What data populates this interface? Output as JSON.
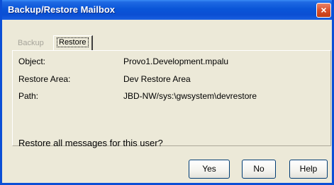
{
  "window": {
    "title": "Backup/Restore Mailbox",
    "close_icon": "×"
  },
  "tabs": [
    {
      "label": "Backup",
      "enabled": false
    },
    {
      "label": "Restore",
      "selected": true
    }
  ],
  "fields": [
    {
      "label": "Object:",
      "value": "Provo1.Development.mpalu"
    },
    {
      "label": "Restore Area:",
      "value": "Dev Restore Area"
    },
    {
      "label": "Path:",
      "value": "JBD-NW/sys:\\gwsystem\\devrestore"
    }
  ],
  "question": "Restore all messages for this user?",
  "buttons": {
    "yes": "Yes",
    "no": "No",
    "help": "Help"
  },
  "colors": {
    "titlebar": "#0b4fd3",
    "window_bg": "#ece9d8",
    "close_button": "#d9502c"
  }
}
